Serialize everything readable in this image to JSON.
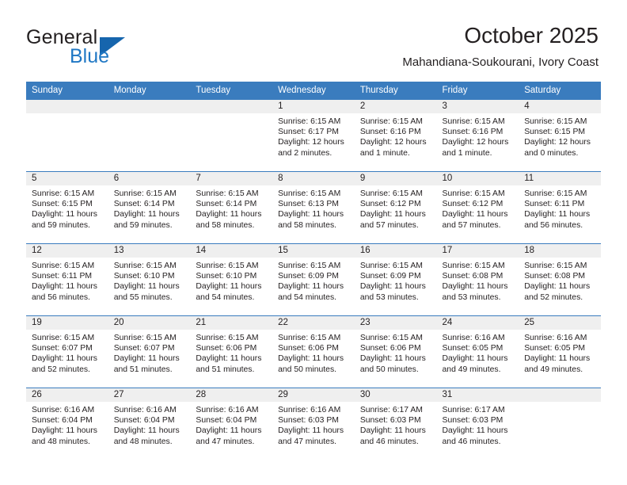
{
  "brand": {
    "name_part1": "General",
    "name_part2": "Blue",
    "triangle_color": "#1665ad",
    "blue_color": "#1f77c4"
  },
  "header": {
    "title": "October 2025",
    "subtitle": "Mahandiana-Soukourani, Ivory Coast"
  },
  "theme": {
    "header_bg": "#3a7cbe",
    "header_text": "#ffffff",
    "daynum_bg": "#efefef",
    "row_border": "#3a7cbe",
    "text": "#231f20"
  },
  "weekdays": [
    "Sunday",
    "Monday",
    "Tuesday",
    "Wednesday",
    "Thursday",
    "Friday",
    "Saturday"
  ],
  "weeks": [
    [
      {
        "day": "",
        "empty": true,
        "sunrise": "",
        "sunset": "",
        "daylight_1": "",
        "daylight_2": ""
      },
      {
        "day": "",
        "empty": true,
        "sunrise": "",
        "sunset": "",
        "daylight_1": "",
        "daylight_2": ""
      },
      {
        "day": "",
        "empty": true,
        "sunrise": "",
        "sunset": "",
        "daylight_1": "",
        "daylight_2": ""
      },
      {
        "day": "1",
        "sunrise": "Sunrise: 6:15 AM",
        "sunset": "Sunset: 6:17 PM",
        "daylight_1": "Daylight: 12 hours",
        "daylight_2": "and 2 minutes."
      },
      {
        "day": "2",
        "sunrise": "Sunrise: 6:15 AM",
        "sunset": "Sunset: 6:16 PM",
        "daylight_1": "Daylight: 12 hours",
        "daylight_2": "and 1 minute."
      },
      {
        "day": "3",
        "sunrise": "Sunrise: 6:15 AM",
        "sunset": "Sunset: 6:16 PM",
        "daylight_1": "Daylight: 12 hours",
        "daylight_2": "and 1 minute."
      },
      {
        "day": "4",
        "sunrise": "Sunrise: 6:15 AM",
        "sunset": "Sunset: 6:15 PM",
        "daylight_1": "Daylight: 12 hours",
        "daylight_2": "and 0 minutes."
      }
    ],
    [
      {
        "day": "5",
        "sunrise": "Sunrise: 6:15 AM",
        "sunset": "Sunset: 6:15 PM",
        "daylight_1": "Daylight: 11 hours",
        "daylight_2": "and 59 minutes."
      },
      {
        "day": "6",
        "sunrise": "Sunrise: 6:15 AM",
        "sunset": "Sunset: 6:14 PM",
        "daylight_1": "Daylight: 11 hours",
        "daylight_2": "and 59 minutes."
      },
      {
        "day": "7",
        "sunrise": "Sunrise: 6:15 AM",
        "sunset": "Sunset: 6:14 PM",
        "daylight_1": "Daylight: 11 hours",
        "daylight_2": "and 58 minutes."
      },
      {
        "day": "8",
        "sunrise": "Sunrise: 6:15 AM",
        "sunset": "Sunset: 6:13 PM",
        "daylight_1": "Daylight: 11 hours",
        "daylight_2": "and 58 minutes."
      },
      {
        "day": "9",
        "sunrise": "Sunrise: 6:15 AM",
        "sunset": "Sunset: 6:12 PM",
        "daylight_1": "Daylight: 11 hours",
        "daylight_2": "and 57 minutes."
      },
      {
        "day": "10",
        "sunrise": "Sunrise: 6:15 AM",
        "sunset": "Sunset: 6:12 PM",
        "daylight_1": "Daylight: 11 hours",
        "daylight_2": "and 57 minutes."
      },
      {
        "day": "11",
        "sunrise": "Sunrise: 6:15 AM",
        "sunset": "Sunset: 6:11 PM",
        "daylight_1": "Daylight: 11 hours",
        "daylight_2": "and 56 minutes."
      }
    ],
    [
      {
        "day": "12",
        "sunrise": "Sunrise: 6:15 AM",
        "sunset": "Sunset: 6:11 PM",
        "daylight_1": "Daylight: 11 hours",
        "daylight_2": "and 56 minutes."
      },
      {
        "day": "13",
        "sunrise": "Sunrise: 6:15 AM",
        "sunset": "Sunset: 6:10 PM",
        "daylight_1": "Daylight: 11 hours",
        "daylight_2": "and 55 minutes."
      },
      {
        "day": "14",
        "sunrise": "Sunrise: 6:15 AM",
        "sunset": "Sunset: 6:10 PM",
        "daylight_1": "Daylight: 11 hours",
        "daylight_2": "and 54 minutes."
      },
      {
        "day": "15",
        "sunrise": "Sunrise: 6:15 AM",
        "sunset": "Sunset: 6:09 PM",
        "daylight_1": "Daylight: 11 hours",
        "daylight_2": "and 54 minutes."
      },
      {
        "day": "16",
        "sunrise": "Sunrise: 6:15 AM",
        "sunset": "Sunset: 6:09 PM",
        "daylight_1": "Daylight: 11 hours",
        "daylight_2": "and 53 minutes."
      },
      {
        "day": "17",
        "sunrise": "Sunrise: 6:15 AM",
        "sunset": "Sunset: 6:08 PM",
        "daylight_1": "Daylight: 11 hours",
        "daylight_2": "and 53 minutes."
      },
      {
        "day": "18",
        "sunrise": "Sunrise: 6:15 AM",
        "sunset": "Sunset: 6:08 PM",
        "daylight_1": "Daylight: 11 hours",
        "daylight_2": "and 52 minutes."
      }
    ],
    [
      {
        "day": "19",
        "sunrise": "Sunrise: 6:15 AM",
        "sunset": "Sunset: 6:07 PM",
        "daylight_1": "Daylight: 11 hours",
        "daylight_2": "and 52 minutes."
      },
      {
        "day": "20",
        "sunrise": "Sunrise: 6:15 AM",
        "sunset": "Sunset: 6:07 PM",
        "daylight_1": "Daylight: 11 hours",
        "daylight_2": "and 51 minutes."
      },
      {
        "day": "21",
        "sunrise": "Sunrise: 6:15 AM",
        "sunset": "Sunset: 6:06 PM",
        "daylight_1": "Daylight: 11 hours",
        "daylight_2": "and 51 minutes."
      },
      {
        "day": "22",
        "sunrise": "Sunrise: 6:15 AM",
        "sunset": "Sunset: 6:06 PM",
        "daylight_1": "Daylight: 11 hours",
        "daylight_2": "and 50 minutes."
      },
      {
        "day": "23",
        "sunrise": "Sunrise: 6:15 AM",
        "sunset": "Sunset: 6:06 PM",
        "daylight_1": "Daylight: 11 hours",
        "daylight_2": "and 50 minutes."
      },
      {
        "day": "24",
        "sunrise": "Sunrise: 6:16 AM",
        "sunset": "Sunset: 6:05 PM",
        "daylight_1": "Daylight: 11 hours",
        "daylight_2": "and 49 minutes."
      },
      {
        "day": "25",
        "sunrise": "Sunrise: 6:16 AM",
        "sunset": "Sunset: 6:05 PM",
        "daylight_1": "Daylight: 11 hours",
        "daylight_2": "and 49 minutes."
      }
    ],
    [
      {
        "day": "26",
        "sunrise": "Sunrise: 6:16 AM",
        "sunset": "Sunset: 6:04 PM",
        "daylight_1": "Daylight: 11 hours",
        "daylight_2": "and 48 minutes."
      },
      {
        "day": "27",
        "sunrise": "Sunrise: 6:16 AM",
        "sunset": "Sunset: 6:04 PM",
        "daylight_1": "Daylight: 11 hours",
        "daylight_2": "and 48 minutes."
      },
      {
        "day": "28",
        "sunrise": "Sunrise: 6:16 AM",
        "sunset": "Sunset: 6:04 PM",
        "daylight_1": "Daylight: 11 hours",
        "daylight_2": "and 47 minutes."
      },
      {
        "day": "29",
        "sunrise": "Sunrise: 6:16 AM",
        "sunset": "Sunset: 6:03 PM",
        "daylight_1": "Daylight: 11 hours",
        "daylight_2": "and 47 minutes."
      },
      {
        "day": "30",
        "sunrise": "Sunrise: 6:17 AM",
        "sunset": "Sunset: 6:03 PM",
        "daylight_1": "Daylight: 11 hours",
        "daylight_2": "and 46 minutes."
      },
      {
        "day": "31",
        "sunrise": "Sunrise: 6:17 AM",
        "sunset": "Sunset: 6:03 PM",
        "daylight_1": "Daylight: 11 hours",
        "daylight_2": "and 46 minutes."
      },
      {
        "day": "",
        "empty": true,
        "sunrise": "",
        "sunset": "",
        "daylight_1": "",
        "daylight_2": ""
      }
    ]
  ]
}
